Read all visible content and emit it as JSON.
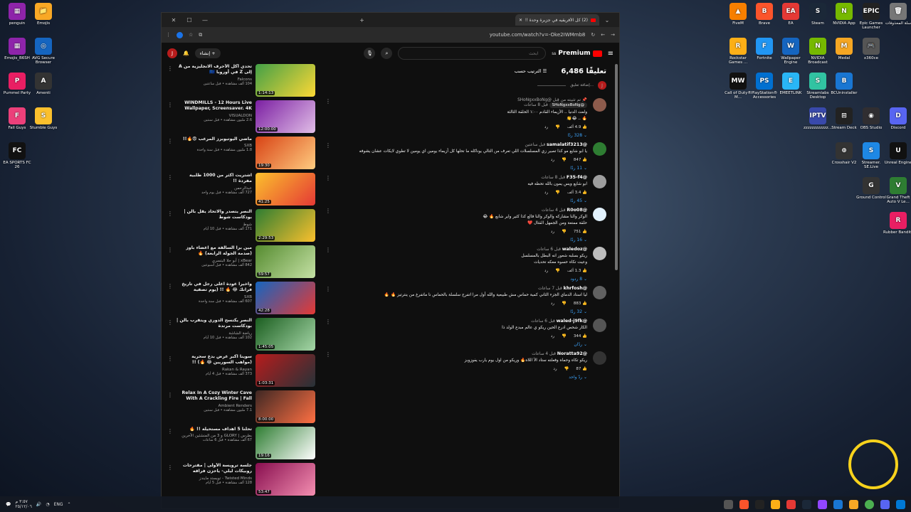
{
  "desktop_icons_right": [
    {
      "label": "FiveM",
      "color": "#f77f00",
      "glyph": "▲"
    },
    {
      "label": "Brave",
      "color": "#fb542b",
      "glyph": "B"
    },
    {
      "label": "EA",
      "color": "#e53935",
      "glyph": "EA"
    },
    {
      "label": "Steam",
      "color": "#1b2838",
      "glyph": "S"
    },
    {
      "label": "NVIDIA App",
      "color": "#76b900",
      "glyph": "N"
    },
    {
      "label": "Epic Games Launcher",
      "color": "#222",
      "glyph": "EPIC"
    },
    {
      "label": "سلة المحذوفات",
      "color": "#777",
      "glyph": "🗑"
    },
    {
      "label": "Rockstar Games ...",
      "color": "#fcaf17",
      "glyph": "R"
    },
    {
      "label": "Fortnite",
      "color": "#2196f3",
      "glyph": "F"
    },
    {
      "label": "Wallpaper Engine",
      "color": "#1565c0",
      "glyph": "W"
    },
    {
      "label": "NVIDIA Broadcast",
      "color": "#76b900",
      "glyph": "N"
    },
    {
      "label": "Medal",
      "color": "#f5a623",
      "glyph": "M"
    },
    {
      "label": "x360ce",
      "color": "#555",
      "glyph": "🎮"
    },
    {
      "label": "Call of Duty® M...",
      "color": "#111",
      "glyph": "MW"
    },
    {
      "label": "PlayStation® Accessories",
      "color": "#0070d1",
      "glyph": "PS"
    },
    {
      "label": "EMEETLINK",
      "color": "#29b6f6",
      "glyph": "E"
    },
    {
      "label": "Streamlabs Desktop",
      "color": "#31c3a2",
      "glyph": "S"
    },
    {
      "label": "BCUninstaller",
      "color": "#1976d2",
      "glyph": "B"
    },
    {
      "label": "zzzzzzzzzzzz...",
      "color": "#3949ab",
      "glyph": "IPTV"
    },
    {
      "label": "Stream Deck",
      "color": "#222",
      "glyph": "⊞"
    },
    {
      "label": "OBS Studio",
      "color": "#302e31",
      "glyph": "◉"
    },
    {
      "label": "Discord",
      "color": "#5865f2",
      "glyph": "D"
    },
    {
      "label": "Crosshair V2",
      "color": "#333",
      "glyph": "⊕"
    },
    {
      "label": "Streamer. SE.Live",
      "color": "#1e88e5",
      "glyph": "S"
    },
    {
      "label": "Unreal Engine",
      "color": "#111",
      "glyph": "U"
    },
    {
      "label": "Ground Control",
      "color": "#333",
      "glyph": "G"
    },
    {
      "label": "Grand Theft Auto V Le...",
      "color": "#2e7d32",
      "glyph": "V"
    },
    {
      "label": "Rubber Bandits",
      "color": "#e91e63",
      "glyph": "R"
    }
  ],
  "desktop_icons_left": [
    {
      "label": "penguin",
      "color": "#8e24aa",
      "glyph": "▦"
    },
    {
      "label": "Emojis",
      "color": "#f9a825",
      "glyph": "📁"
    },
    {
      "label": "Emojis_B6SH",
      "color": "#8e24aa",
      "glyph": "▦"
    },
    {
      "label": "AVG Secure Browser",
      "color": "#1565c0",
      "glyph": "◎"
    },
    {
      "label": "Pummel Party",
      "color": "#e91e63",
      "glyph": "P"
    },
    {
      "label": "Amenti",
      "color": "#333",
      "glyph": "A"
    },
    {
      "label": "Fall Guys",
      "color": "#ec407a",
      "glyph": "F"
    },
    {
      "label": "Stumble Guys",
      "color": "#fbc02d",
      "glyph": "S"
    },
    {
      "label": "EA SPORTS FC 26",
      "color": "#111",
      "glyph": "FC"
    }
  ],
  "browser": {
    "tab_title": "(2) كل الأفريقيه في جزيرة وحدة !!...",
    "url": "youtube.com/watch?v=-Oke2IWMmb8"
  },
  "youtube": {
    "brand": "Premium",
    "region": "SA",
    "search_placeholder": "ابحث",
    "create_label": "إنشاء",
    "avatar_letter": "J"
  },
  "comments_header": {
    "count": "6,486 تعليقًا",
    "sort_label": "الترتيب حسب",
    "add_placeholder": "إضافة تعليق..."
  },
  "comments": [
    {
      "user": "@SHoNgxxBoNg",
      "time": "قبل 8 ساعات",
      "pinned": "تم تثبيته من قِبل @SHoNgxxBoNg",
      "text": "ولعت الدنيا .. الأزيماء القادم ١:٠٠ الحلقة الثالثة\n🔥 .. 😂👏",
      "likes": "4.9 ألف",
      "replies": "328 ردًا",
      "avatar": "#8d5b4c"
    },
    {
      "user": "@samalatif3213",
      "time": "قبل ساعتين",
      "text": "يا ابو شايع مو كذا تصير زي المسلسلات اللي تعرف من التالي يوناكله ما تحلها كل أزيماء يومين اي يومين لا تطوي لايكات عشان يشوفه",
      "likes": "847",
      "replies": "11 ردًا",
      "avatar": "#2e7d32"
    },
    {
      "user": "@F35-f4",
      "time": "قبل 8 ساعات",
      "text": "ابو شايع ويس يمون بالله تحطه فيه",
      "likes": "3.4 ألف",
      "replies": "45 ردًا",
      "avatar": "#9e9e9e"
    },
    {
      "user": "@R0o08",
      "time": "قبل 4 ساعات",
      "text": "الوكر والنا مشاركه والوكر والنا فالع كذا كثير واير شابع 🔥 😂\nحلقة ممتعة ومن الجمهل القتال ❤️",
      "likes": "751",
      "replies": "16 ردًا",
      "avatar": "#e3f2fd"
    },
    {
      "user": "@waledoz",
      "time": "قبل 6 ساعات",
      "text": "ريكو بسلبه شعور انه البطل بالمسلسل\nوعيت تكاه حسوه معكه تحديات",
      "likes": "1.3 ألف",
      "replies": "8 ردود",
      "avatar": "#bdbdbd"
    },
    {
      "user": "@khrfosh",
      "time": "قبل 7 ساعات",
      "text": "ليا استاد الدماي الجزء الثاني كمية حماس مش طبيعية والله أول مرا اتفرج سلسلة بالحماس نا ماتفرغ من ينترتيز 🔥 🔥",
      "likes": "883",
      "replies": "32 ردًا",
      "avatar": "#616161"
    },
    {
      "user": "@waled-j9fk",
      "time": "قبل 6 ساعات",
      "text": "الكار شحص ادرع الحين ريكو ي عالم مبدع الولد ذا",
      "likes": "344",
      "replies": "ردّان",
      "avatar": "#555"
    },
    {
      "user": "@Noratta92",
      "time": "قبل 4 ساعات",
      "text": "ريكو تكاه وحماه وفعلته ستاد الأ اللاه🔥 وريكو من اول يوم يارب يفوزوبز",
      "likes": "87",
      "replies": "ردّ واحد",
      "avatar": "#333"
    }
  ],
  "related": [
    {
      "title": "تحدي أكل الأحرف الانجليزية من A إلى Z في أوروبا 🇪🇺",
      "channel": "Falcons",
      "stats": "104 ألف مشاهدة • قبل ساعتين",
      "duration": "1:14:13",
      "c1": "#43a047",
      "c2": "#fdd835"
    },
    {
      "title": "WINDMILLS - 12 Hours Live Wallpaper, Screensaver. 4K Ultra",
      "channel": "VISUALDON",
      "stats": "2.6 مليون مشاهدة • قبل سنتين",
      "duration": "12:00:00",
      "c1": "#7b1fa2",
      "c2": "#e1bee7"
    },
    {
      "title": "ماضي اليوتيوبرز المرعب 😨🔥!!",
      "channel": "SXB",
      "stats": "1.8 مليون مشاهدة • قبل سنة واحدة",
      "duration": "19:30",
      "c1": "#d84315",
      "c2": "#ffcc80"
    },
    {
      "title": "اشتريت اكثر من 1000 طلبية مفردة !!",
      "channel": "عبدالرحمن",
      "stats": "727 ألف مشاهدة • قبل يوم واحد",
      "duration": "41:25",
      "c1": "#fbc02d",
      "c2": "#e53935"
    },
    {
      "title": "النصر يتصدر والاتحاد يقل بالن | بودكاست شوط",
      "channel": "شوط",
      "stats": "171 ألف مشاهدة • قبل 10 أيام",
      "duration": "2:29:53",
      "c1": "#2e7d32",
      "c2": "#fbc02d"
    },
    {
      "title": "مين برا السالفة مع اعضاء باوز (صدمة الجولة الرابعة) 🔥",
      "channel": "xBear | أبو حلا البتسري",
      "stats": "842 ألف مشاهدة • قبل أسبوعين",
      "duration": "59:57",
      "c1": "#558b2f",
      "c2": "#c5e1a5"
    },
    {
      "title": "واخيراً عودة اعلى رجل في تاريخ فرانك 😂 🔥 !! (يوم تصفية الحسابات 🔥)",
      "channel": "SXB",
      "stats": "607 ألف مشاهدة • قبل سنة واحدة",
      "duration": "42:28",
      "c1": "#1565c0",
      "c2": "#e53935"
    },
    {
      "title": "النصر يكتسح الدوري ويتقرب بالن | بودكاست مرتدة",
      "channel": "رياضة الشاشة",
      "stats": "102 ألف مشاهدة • قبل 10 أيام",
      "duration": "1:45:05",
      "c1": "#1b5e20",
      "c2": "#a5d6a7"
    },
    {
      "title": "سوينا اكبر عرض بدع سحرية (مواهب السوريين 😂 🔥) !!",
      "channel": "Rakan & Rayan",
      "stats": "373 ألف مشاهدة • قبل 4 أيام",
      "duration": "1:03:31",
      "c1": "#b71c1c",
      "c2": "#263238"
    },
    {
      "title": "Relax In A Cozy Winter Cave With A Crackling Fire | Fall",
      "channel": "Ambient Renders",
      "stats": "7.1 مليون مشاهدة • قبل سنتين",
      "duration": "8:00:00",
      "c1": "#3e2723",
      "c2": "#ff7043"
    },
    {
      "title": "تحلنا 5 اهداف مستحيلة !! 🔥",
      "channel": "بطرس | GLORY و 3 من المنشئين الآخرين",
      "stats": "67 ألف مشاهدة • قبل 6 ساعات",
      "duration": "19:16",
      "c1": "#2e7d32",
      "c2": "#ffffff"
    },
    {
      "title": "جلسة ترويسة الأولى | مقترحات روبيكات ليلي- ياحزن فراقه فرويسة مايصلح- فريق ترويسة...",
      "channel": "Twisted Minds - تويستد مايندز",
      "stats": "128 ألف مشاهدة • قبل 5 أيام",
      "duration": "53:47",
      "c1": "#880e4f",
      "c2": "#f48fb1"
    }
  ],
  "taskbar": {
    "time": "٣:٥٧ م",
    "date": "٢٥/١٢/٠٦",
    "lang": "ENG"
  }
}
